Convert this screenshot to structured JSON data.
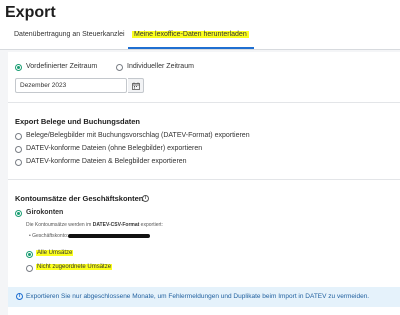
{
  "header": {
    "title": "Export",
    "tabs": [
      {
        "label": "Datenübertragung an Steuerkanzlei"
      },
      {
        "label": "Meine lexoffice-Daten herunterladen"
      }
    ]
  },
  "period": {
    "options": [
      {
        "label": "Vordefinierter Zeitraum",
        "checked": true
      },
      {
        "label": "Individueller Zeitraum",
        "checked": false
      }
    ],
    "selected_value": "Dezember 2023",
    "calendar_icon": "calendar-icon"
  },
  "export_receipts": {
    "heading": "Export Belege und Buchungsdaten",
    "options": [
      {
        "label": "Belege/Belegbilder mit Buchungsvorschlag (DATEV-Format) exportieren",
        "checked": false
      },
      {
        "label": "DATEV-konforme Dateien (ohne Belegbilder) exportieren",
        "checked": false
      },
      {
        "label": "DATEV-konforme Dateien & Belegbilder exportieren",
        "checked": false
      }
    ]
  },
  "account_transactions": {
    "heading": "Kontoumsätze der Geschäftskonten",
    "info_icon": "info-icon",
    "account": {
      "label": "Girokonten",
      "checked": true
    },
    "description_prefix": "Die Kontoumsätze werden im ",
    "description_bold": "DATEV-CSV-Format",
    "description_suffix": " exportiert:",
    "bullet_label": "Geschäftskonto:",
    "filter_options": [
      {
        "label": "Alle Umsätze",
        "checked": true
      },
      {
        "label": "Nicht zugeordnete Umsätze",
        "checked": false
      }
    ]
  },
  "info_bar": {
    "icon": "info-icon",
    "text": "Exportieren Sie nur abgeschlossene Monate, um Fehlermeldungen und Duplikate beim Import in DATEV zu vermeiden."
  },
  "colors": {
    "accent": "#1a9e73",
    "tab_underline": "#1f6fd1",
    "highlight": "#fbff1e",
    "info_bg": "#e5f2fb"
  }
}
